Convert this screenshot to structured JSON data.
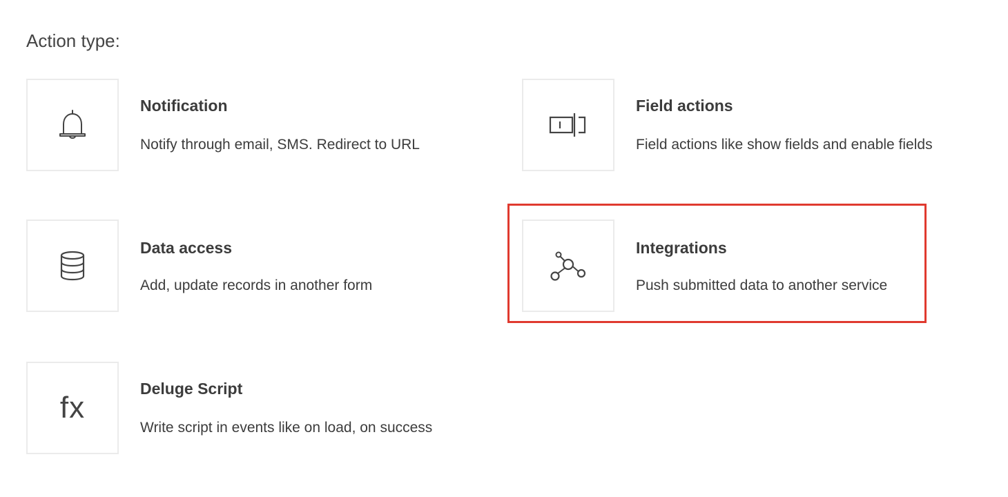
{
  "heading": "Action type:",
  "actions": {
    "notification": {
      "title": "Notification",
      "description": "Notify through email, SMS. Redirect to URL",
      "icon": "bell-icon"
    },
    "field_actions": {
      "title": "Field actions",
      "description": "Field actions like show fields and enable fields",
      "icon": "field-toggle-icon"
    },
    "data_access": {
      "title": "Data access",
      "description": "Add, update records in another form",
      "icon": "database-icon"
    },
    "integrations": {
      "title": "Integrations",
      "description": "Push submitted data to another service",
      "icon": "network-nodes-icon",
      "highlighted": true
    },
    "deluge_script": {
      "title": "Deluge Script",
      "description": "Write script in events like on load, on success",
      "icon": "fx-icon",
      "icon_text": "fx"
    }
  },
  "colors": {
    "highlight_border": "#e03a2f",
    "icon_box_border": "#ebebeb",
    "text": "#3c3c3c"
  }
}
